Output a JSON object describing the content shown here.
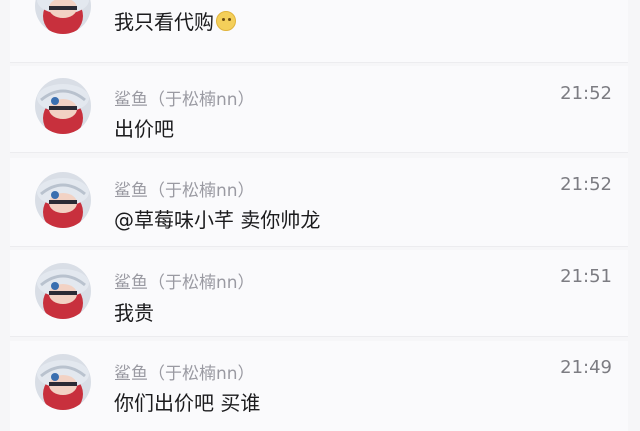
{
  "messages": [
    {
      "sender": "",
      "time": "",
      "text": "我只看代购",
      "emoji": "smile-emoji-icon"
    },
    {
      "sender": "鲨鱼（于松楠nn）",
      "time": "21:52",
      "text": "出价吧"
    },
    {
      "sender": "鲨鱼（于松楠nn）",
      "time": "21:52",
      "text": "@草莓味小芊 卖你帅龙"
    },
    {
      "sender": "鲨鱼（于松楠nn）",
      "time": "21:51",
      "text": "我贵"
    },
    {
      "sender": "鲨鱼（于松楠nn）",
      "time": "21:49",
      "text": "你们出价吧 买谁"
    }
  ],
  "colors": {
    "background": "#f6f6f8",
    "card": "#fafafc",
    "name_gray": "#9a9aa2",
    "text": "#1b1b1d",
    "avatar_red": "#c8303d",
    "avatar_hat": "#dfe6ee"
  }
}
